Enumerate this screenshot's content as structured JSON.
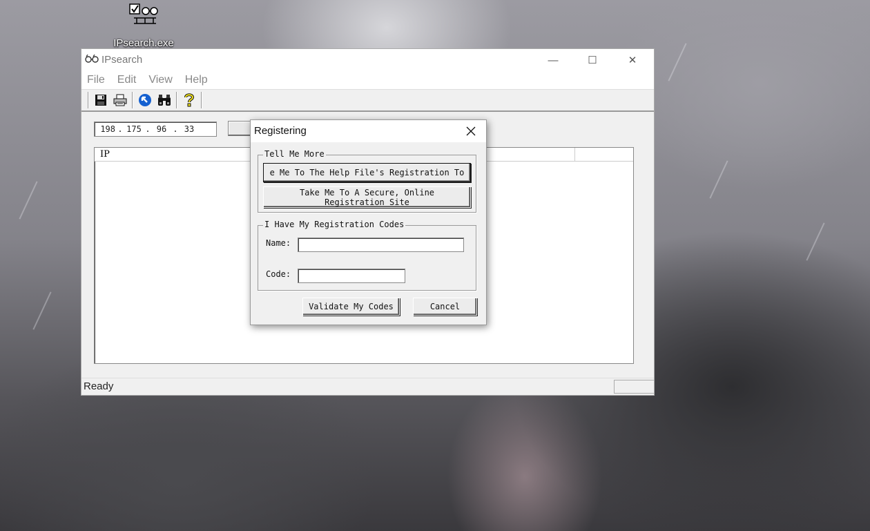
{
  "desktop": {
    "icon_label": "IPsearch.exe"
  },
  "window": {
    "title": "IPsearch",
    "minimize_glyph": "—",
    "maximize_glyph": "☐",
    "close_glyph": "✕"
  },
  "menu": {
    "file": "File",
    "edit": "Edit",
    "view": "View",
    "help": "Help"
  },
  "toolbar": {
    "icons": [
      "save-icon",
      "print-icon",
      "back-arrow-icon",
      "binoculars-icon",
      "help-icon"
    ]
  },
  "ip_input": {
    "octets": [
      "198",
      "175",
      "96",
      "33"
    ],
    "separator": "."
  },
  "list": {
    "columns": [
      "IP",
      "",
      ""
    ]
  },
  "status": {
    "text": "Ready"
  },
  "dialog": {
    "title": "Registering",
    "group1_label": "Tell Me More",
    "help_button": "e Me To The Help File's Registration To",
    "online_button_line1": "Take Me To A Secure, Online",
    "online_button_line2": "Registration Site",
    "group2_label": "I Have My Registration Codes",
    "name_label": "Name:",
    "name_value": "",
    "code_label": "Code:",
    "code_value": "",
    "validate_button": "Validate My Codes",
    "cancel_button": "Cancel"
  }
}
